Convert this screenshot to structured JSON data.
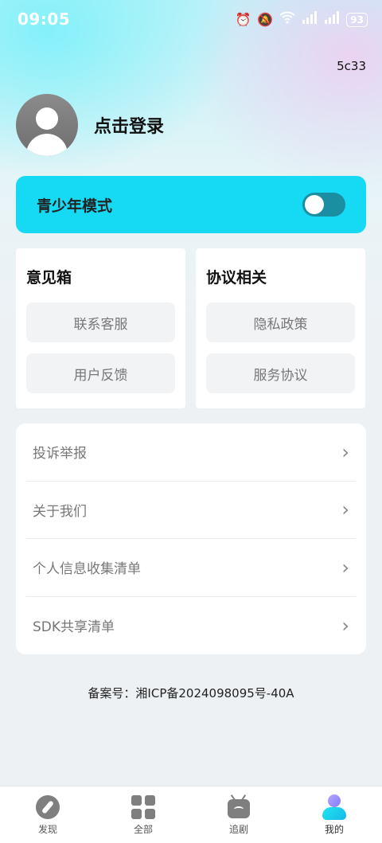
{
  "status_bar": {
    "time": "09:05",
    "icons": [
      "alarm-icon",
      "mute-icon",
      "wifi-icon",
      "signal-icon",
      "signal-icon"
    ],
    "battery": "93"
  },
  "header": {
    "code": "5c33"
  },
  "profile": {
    "login_label": "点击登录"
  },
  "teen_mode": {
    "label": "青少年模式",
    "enabled": false
  },
  "cards": {
    "feedback": {
      "title": "意见箱",
      "buttons": [
        "联系客服",
        "用户反馈"
      ]
    },
    "agreements": {
      "title": "协议相关",
      "buttons": [
        "隐私政策",
        "服务协议"
      ]
    }
  },
  "menu": {
    "items": [
      "投诉举报",
      "关于我们",
      "个人信息收集清单",
      "SDK共享清单"
    ]
  },
  "footer": {
    "icp": "备案号：湘ICP备2024098095号-40A"
  },
  "tabbar": {
    "items": [
      {
        "label": "发现",
        "icon": "compass-icon"
      },
      {
        "label": "全部",
        "icon": "grid-icon"
      },
      {
        "label": "追剧",
        "icon": "tv-icon"
      },
      {
        "label": "我的",
        "icon": "user-icon"
      }
    ],
    "active_index": 3
  },
  "colors": {
    "accent": "#16d9f3",
    "toggle_track": "#1c8ea1"
  }
}
